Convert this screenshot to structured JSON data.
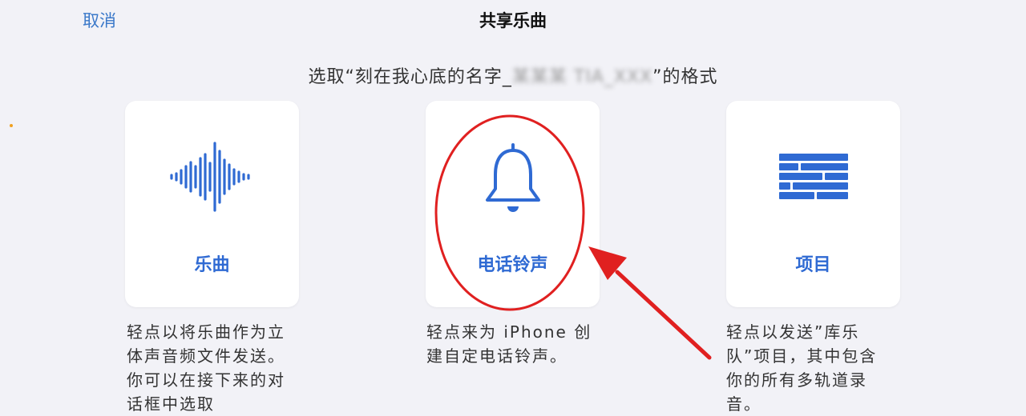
{
  "header": {
    "cancel_label": "取消",
    "title": "共享乐曲"
  },
  "subtitle": {
    "prefix": "选取“刻在我心底的名字_",
    "blurred": "某某某 TIA_XXX",
    "suffix": "”的格式"
  },
  "options": [
    {
      "label": "乐曲",
      "icon": "waveform-icon",
      "description": "轻点以将乐曲作为立体声音频文件发送。你可以在接下来的对话框中选取"
    },
    {
      "label": "电话铃声",
      "icon": "bell-icon",
      "description": "轻点来为 iPhone 创建自定电话铃声。"
    },
    {
      "label": "项目",
      "icon": "tracks-icon",
      "description": "轻点以发送”库乐队”项目，其中包含你的所有多轨道录音。"
    }
  ],
  "colors": {
    "accent": "#2f6ad3",
    "annotation": "#e02020",
    "background": "#f2f2f7"
  }
}
